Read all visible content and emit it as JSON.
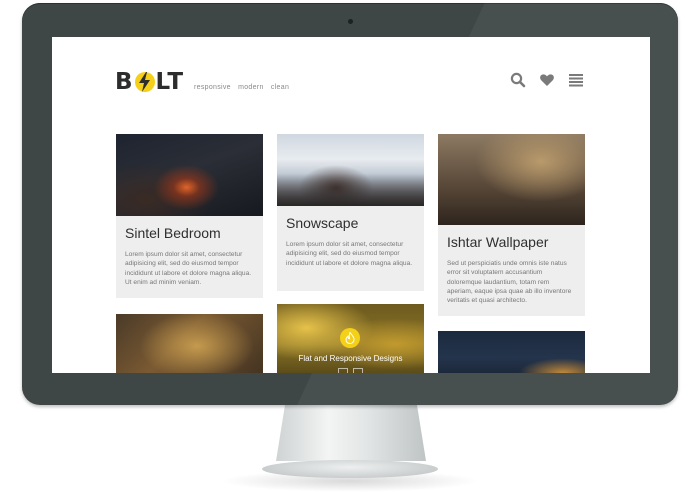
{
  "brand": {
    "logo_left": "B",
    "logo_right": "LT",
    "tagline": [
      "responsive",
      "modern",
      "clean"
    ],
    "accent_color": "#f4d019"
  },
  "nav": {
    "icons": [
      "search-icon",
      "heart-icon",
      "menu-icon"
    ]
  },
  "cards": [
    {
      "title": "Sintel Bedroom",
      "excerpt": "Lorem ipsum dolor sit amet, consectetur adipisicing elit, sed do eiusmod tempor incididunt ut labore et dolore magna aliqua. Ut enim ad minim veniam."
    },
    {
      "title": "Snowscape",
      "excerpt": "Lorem ipsum dolor sit amet, consectetur adipisicing elit, sed do eiusmod tempor incididunt ut labore et dolore magna aliqua."
    },
    {
      "title": "Ishtar Wallpaper",
      "excerpt": "Sed ut perspiciatis unde omnis iste natus error sit voluptatem accusantium doloremque laudantium, totam rem aperiam, eaque ipsa quae ab illo inventore veritatis et quasi architecto."
    }
  ],
  "feature": {
    "title": "Flat and Responsive Designs",
    "icon": "flame-icon"
  }
}
